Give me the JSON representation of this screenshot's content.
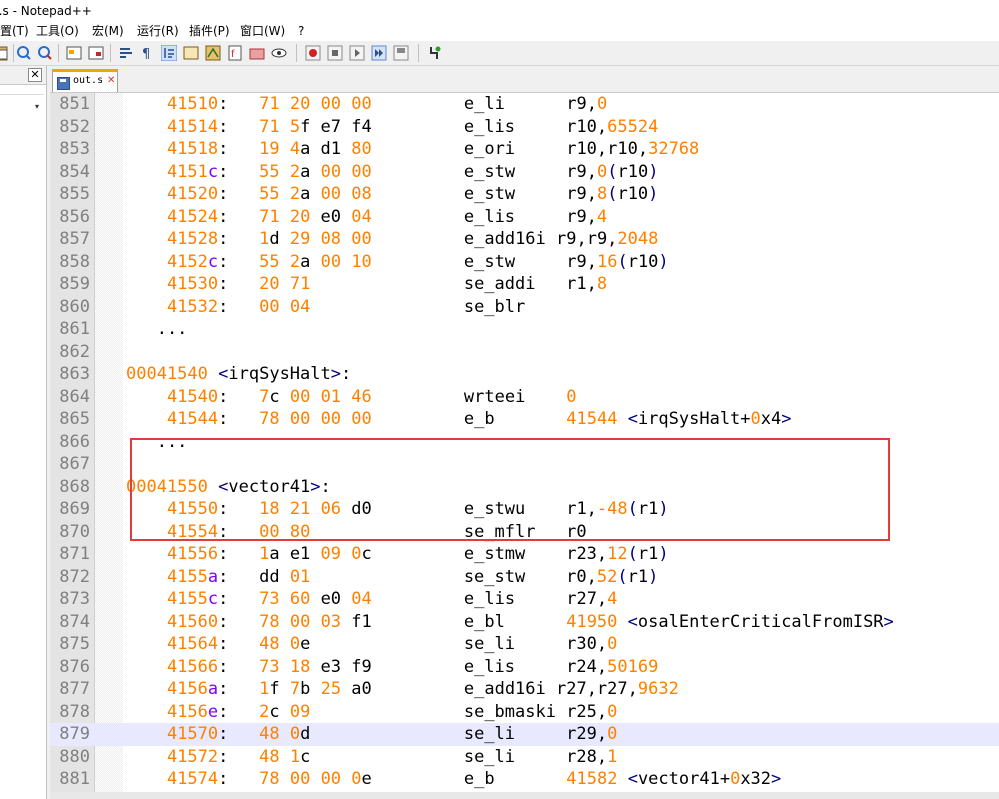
{
  "window": {
    "title": "t.s - Notepad++"
  },
  "menu": [
    "置(T)",
    "工具(O)",
    "宏(M)",
    "运行(R)",
    "插件(P)",
    "窗口(W)",
    "?"
  ],
  "tab": {
    "label": "out.s"
  },
  "editor": {
    "lines": [
      {
        "n": "851",
        "addr": "41510:",
        "bytes": "71 20 00 00",
        "mn": "e_li",
        "ops": "r9,0"
      },
      {
        "n": "852",
        "addr": "41514:",
        "bytes": "71 5f e7 f4",
        "mn": "e_lis",
        "ops": "r10,65524"
      },
      {
        "n": "853",
        "addr": "41518:",
        "bytes": "19 4a d1 80",
        "mn": "e_ori",
        "ops": "r10,r10,32768"
      },
      {
        "n": "854",
        "addr": "4151c:",
        "bytes": "55 2a 00 00",
        "mn": "e_stw",
        "ops": "r9,0(r10)"
      },
      {
        "n": "855",
        "addr": "41520:",
        "bytes": "55 2a 00 08",
        "mn": "e_stw",
        "ops": "r9,8(r10)"
      },
      {
        "n": "856",
        "addr": "41524:",
        "bytes": "71 20 e0 04",
        "mn": "e_lis",
        "ops": "r9,4"
      },
      {
        "n": "857",
        "addr": "41528:",
        "bytes": "1d 29 08 00",
        "mn": "e_add16i",
        "ops": "r9,r9,2048"
      },
      {
        "n": "858",
        "addr": "4152c:",
        "bytes": "55 2a 00 10",
        "mn": "e_stw",
        "ops": "r9,16(r10)"
      },
      {
        "n": "859",
        "addr": "41530:",
        "bytes": "20 71",
        "mn": "se_addi",
        "ops": "r1,8"
      },
      {
        "n": "860",
        "addr": "41532:",
        "bytes": "00 04",
        "mn": "se_blr",
        "ops": ""
      },
      {
        "n": "861",
        "text": "   ..."
      },
      {
        "n": "862",
        "text": ""
      },
      {
        "n": "863",
        "label": "00041540 <irqSysHalt>:"
      },
      {
        "n": "864",
        "addr": "41540:",
        "bytes": "7c 00 01 46",
        "mn": "wrteei",
        "ops": "0"
      },
      {
        "n": "865",
        "addr": "41544:",
        "bytes": "78 00 00 00",
        "mn": "e_b",
        "ops": "41544 <irqSysHalt+0x4>"
      },
      {
        "n": "866",
        "text": "   ..."
      },
      {
        "n": "867",
        "text": ""
      },
      {
        "n": "868",
        "label": "00041550 <vector41>:"
      },
      {
        "n": "869",
        "addr": "41550:",
        "bytes": "18 21 06 d0",
        "mn": "e_stwu",
        "ops": "r1,-48(r1)"
      },
      {
        "n": "870",
        "addr": "41554:",
        "bytes": "00 80",
        "mn": "se_mflr",
        "ops": "r0"
      },
      {
        "n": "871",
        "addr": "41556:",
        "bytes": "1a e1 09 0c",
        "mn": "e_stmw",
        "ops": "r23,12(r1)"
      },
      {
        "n": "872",
        "addr": "4155a:",
        "bytes": "dd 01",
        "mn": "se_stw",
        "ops": "r0,52(r1)"
      },
      {
        "n": "873",
        "addr": "4155c:",
        "bytes": "73 60 e0 04",
        "mn": "e_lis",
        "ops": "r27,4"
      },
      {
        "n": "874",
        "addr": "41560:",
        "bytes": "78 00 03 f1",
        "mn": "e_bl",
        "ops": "41950 <osalEnterCriticalFromISR>"
      },
      {
        "n": "875",
        "addr": "41564:",
        "bytes": "48 0e",
        "mn": "se_li",
        "ops": "r30,0"
      },
      {
        "n": "876",
        "addr": "41566:",
        "bytes": "73 18 e3 f9",
        "mn": "e_lis",
        "ops": "r24,50169"
      },
      {
        "n": "877",
        "addr": "4156a:",
        "bytes": "1f 7b 25 a0",
        "mn": "e_add16i",
        "ops": "r27,r27,9632"
      },
      {
        "n": "878",
        "addr": "4156e:",
        "bytes": "2c 09",
        "mn": "se_bmaski",
        "ops": "r25,0"
      },
      {
        "n": "879",
        "addr": "41570:",
        "bytes": "48 0d",
        "mn": "se_li",
        "ops": "r29,0"
      },
      {
        "n": "880",
        "addr": "41572:",
        "bytes": "48 1c",
        "mn": "se_li",
        "ops": "r28,1"
      },
      {
        "n": "881",
        "addr": "41574:",
        "bytes": "78 00 00 0e",
        "mn": "e_b",
        "ops": "41582 <vector41+0x32>"
      }
    ],
    "highlighted_line": "879"
  },
  "colors": {
    "number": "#ff8000",
    "hex_letter": "#8000ff",
    "bracket": "#000080",
    "annotation_box": "#e53a3a"
  }
}
